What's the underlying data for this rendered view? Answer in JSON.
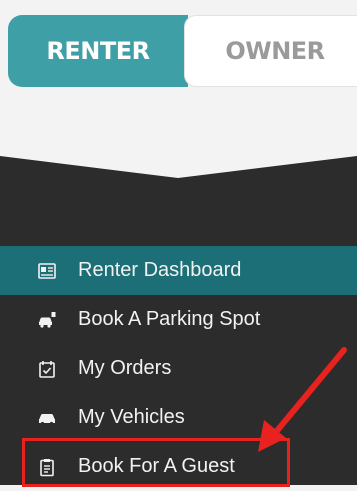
{
  "tabs": {
    "renter_label": "RENTER",
    "owner_label": "OWNER"
  },
  "menu": {
    "items": [
      {
        "label": "Renter Dashboard",
        "icon": "dashboard-icon"
      },
      {
        "label": "Book A Parking Spot",
        "icon": "car-parking-icon"
      },
      {
        "label": "My Orders",
        "icon": "calendar-check-icon"
      },
      {
        "label": "My Vehicles",
        "icon": "car-icon"
      },
      {
        "label": "Book For A Guest",
        "icon": "clipboard-icon"
      }
    ],
    "active_index": 0
  },
  "annotation": {
    "highlight_color": "#e8231f"
  },
  "colors": {
    "accent": "#3f9fa6",
    "active_item": "#1c6f76",
    "sidebar_bg": "#2c2c2c"
  }
}
